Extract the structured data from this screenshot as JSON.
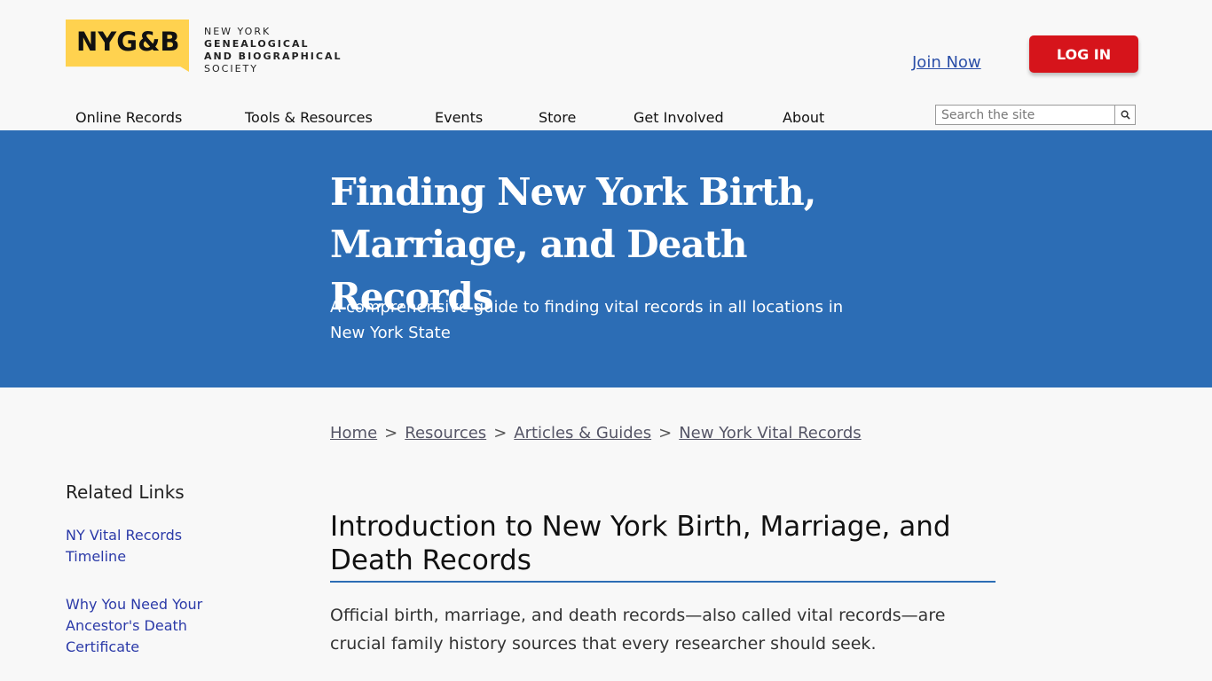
{
  "logo": {
    "mark": "NYG&B",
    "lines": [
      "NEW YORK",
      "GENEALOGICAL",
      "AND BIOGRAPHICAL",
      "SOCIETY"
    ]
  },
  "header": {
    "join_label": "Join Now",
    "login_label": "LOG IN"
  },
  "nav": {
    "items": [
      "Online Records",
      "Tools & Resources",
      "Events",
      "Store",
      "Get Involved",
      "About"
    ]
  },
  "search": {
    "placeholder": "Search the site"
  },
  "hero": {
    "title": "Finding New York Birth, Marriage, and Death Records",
    "subtitle": "A comprehensive guide to finding vital records in all locations in New York State"
  },
  "breadcrumb": {
    "items": [
      "Home",
      "Resources",
      "Articles & Guides",
      "New York Vital Records"
    ],
    "separator": ">"
  },
  "sidebar": {
    "title": "Related Links",
    "links": [
      "NY Vital Records Timeline",
      "Why You Need Your Ancestor's Death Certificate"
    ]
  },
  "content": {
    "heading": "Introduction to New York Birth, Marriage, and Death Records",
    "paragraph": "Official birth, marriage, and death records—also called vital records—are crucial family history sources that every researcher should seek."
  },
  "colors": {
    "accent": "#2c6db5",
    "logo": "#ffd24f",
    "login": "#d6141b",
    "link": "#2b3aa8"
  }
}
